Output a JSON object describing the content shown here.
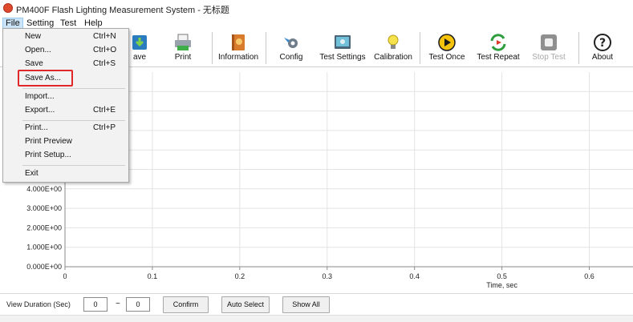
{
  "window": {
    "title": "PM400F Flash Lighting Measurement System - 无标题"
  },
  "menubar": {
    "items": [
      "File",
      "Setting",
      "Test",
      "Help"
    ]
  },
  "toolbar": {
    "buttons": [
      {
        "label": "ave",
        "icon": "save-icon"
      },
      {
        "label": "Print",
        "icon": "printer-icon"
      },
      {
        "label": "Information",
        "icon": "information-book-icon"
      },
      {
        "label": "Config",
        "icon": "config-gear-icon"
      },
      {
        "label": "Test Settings",
        "icon": "test-settings-icon"
      },
      {
        "label": "Calibration",
        "icon": "lightbulb-icon"
      },
      {
        "label": "Test Once",
        "icon": "play-icon"
      },
      {
        "label": "Test Repeat",
        "icon": "repeat-icon"
      },
      {
        "label": "Stop Test",
        "icon": "stop-icon",
        "disabled": true
      },
      {
        "label": "About",
        "icon": "question-icon"
      }
    ]
  },
  "file_menu": {
    "items": [
      {
        "label": "New",
        "shortcut": "Ctrl+N"
      },
      {
        "label": "Open...",
        "shortcut": "Ctrl+O"
      },
      {
        "label": "Save",
        "shortcut": "Ctrl+S"
      },
      {
        "label": "Save As...",
        "shortcut": "",
        "highlighted": true
      },
      {
        "label": "Import...",
        "shortcut": ""
      },
      {
        "label": "Export...",
        "shortcut": "Ctrl+E"
      },
      {
        "label": "Print...",
        "shortcut": "Ctrl+P"
      },
      {
        "label": "Print Preview",
        "shortcut": ""
      },
      {
        "label": "Print Setup...",
        "shortcut": ""
      },
      {
        "label": "Exit",
        "shortcut": ""
      }
    ]
  },
  "chart_data": {
    "type": "line",
    "xlabel": "Time, sec",
    "ylabel": "",
    "x_ticks": [
      0,
      0.1,
      0.2,
      0.3,
      0.4,
      0.5,
      0.6
    ],
    "x_tick_labels": [
      "0",
      "0.1",
      "0.2",
      "0.3",
      "0.4",
      "0.5",
      "0.6"
    ],
    "y_ticks": [
      0,
      1,
      2,
      3,
      4
    ],
    "y_tick_labels": [
      "0.000E+00",
      "1.000E+00",
      "2.000E+00",
      "3.000E+00",
      "4.000E+00"
    ],
    "xlim": [
      0,
      0.65
    ],
    "ylim": [
      0,
      10
    ],
    "grid": true,
    "series": []
  },
  "bottom": {
    "view_duration_label": "View Duration (Sec)",
    "from_value": "0",
    "tilde": "~",
    "to_value": "0",
    "confirm_label": "Confirm",
    "auto_select_label": "Auto Select",
    "show_all_label": "Show All"
  },
  "colors": {
    "accent_highlight": "#e0282a",
    "menu_active": "#cce4f7"
  }
}
